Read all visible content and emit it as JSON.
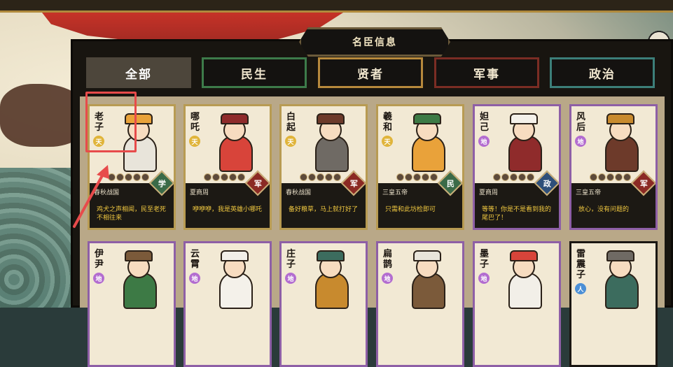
{
  "panel": {
    "title": "名臣信息"
  },
  "tabs": [
    {
      "label": "全部",
      "active": true,
      "border": "#4d463b"
    },
    {
      "label": "民生",
      "active": false,
      "border": "#3d7b4a"
    },
    {
      "label": "贤者",
      "active": false,
      "border": "#b7893c"
    },
    {
      "label": "军事",
      "active": false,
      "border": "#7b2d24"
    },
    {
      "label": "政治",
      "active": false,
      "border": "#3c7f79"
    }
  ],
  "cards": [
    {
      "name": "老子",
      "grade": "天",
      "grade_color": "gold",
      "era": "春秋战国",
      "role": "学",
      "role_color": "#3a6a48",
      "quote": "鸡犬之声相闻，民至老死不相往来",
      "rarity": "gold"
    },
    {
      "name": "哪吒",
      "grade": "天",
      "grade_color": "gold",
      "era": "夏商周",
      "role": "军",
      "role_color": "#8b2a24",
      "quote": "咿咿咿，我是英雄小哪吒",
      "rarity": "gold"
    },
    {
      "name": "白起",
      "grade": "天",
      "grade_color": "gold",
      "era": "春秋战国",
      "role": "军",
      "role_color": "#8b2a24",
      "quote": "备好粮草，马上就打好了",
      "rarity": "gold"
    },
    {
      "name": "羲和",
      "grade": "天",
      "grade_color": "gold",
      "era": "三皇五帝",
      "role": "民",
      "role_color": "#3a6a48",
      "quote": "只需和此坊检即可",
      "rarity": "gold"
    },
    {
      "name": "妲己",
      "grade": "地",
      "grade_color": "purple",
      "era": "夏商周",
      "role": "政",
      "role_color": "#2e4f7a",
      "quote": "等等！你是不是看到我的尾巴了！",
      "rarity": "purple"
    },
    {
      "name": "风后",
      "grade": "地",
      "grade_color": "purple",
      "era": "三皇五帝",
      "role": "军",
      "role_color": "#8b2a24",
      "quote": "放心，没有问题的",
      "rarity": "purple"
    },
    {
      "name": "伊尹",
      "grade": "地",
      "grade_color": "purple",
      "rarity": "purple"
    },
    {
      "name": "云霄",
      "grade": "地",
      "grade_color": "purple",
      "rarity": "purple"
    },
    {
      "name": "庄子",
      "grade": "地",
      "grade_color": "purple",
      "rarity": "purple"
    },
    {
      "name": "扁鹊",
      "grade": "地",
      "grade_color": "purple",
      "rarity": "purple"
    },
    {
      "name": "墨子",
      "grade": "地",
      "grade_color": "purple",
      "rarity": "purple"
    },
    {
      "name": "雷震子",
      "grade": "人",
      "grade_color": "blue",
      "rarity": "black"
    }
  ],
  "stars_per_card": 5
}
